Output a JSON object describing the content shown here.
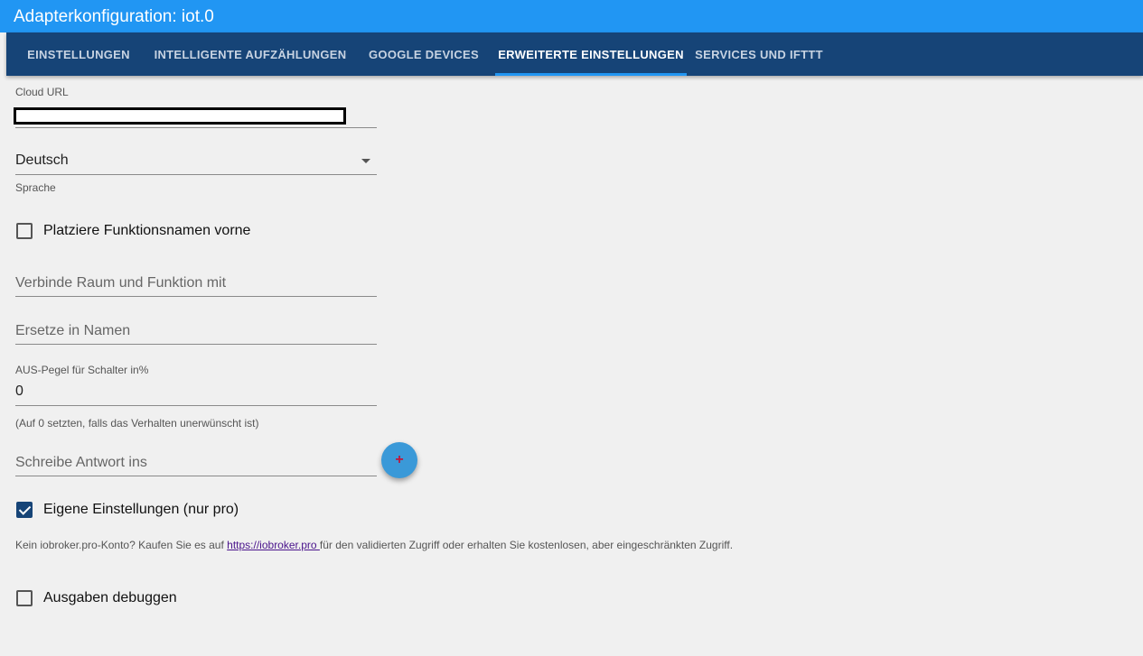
{
  "window": {
    "title": "Adapterkonfiguration: iot.0"
  },
  "tabs": [
    {
      "label": "EINSTELLUNGEN",
      "active": false
    },
    {
      "label": "INTELLIGENTE AUFZÄHLUNGEN",
      "active": false
    },
    {
      "label": "GOOGLE DEVICES",
      "active": false
    },
    {
      "label": "ERWEITERTE EINSTELLUNGEN",
      "active": true
    },
    {
      "label": "SERVICES UND IFTTT",
      "active": false
    }
  ],
  "form": {
    "cloud_url": {
      "label": "Cloud URL",
      "value": ""
    },
    "language": {
      "value": "Deutsch",
      "helper": "Sprache"
    },
    "function_first": {
      "label": "Platziere Funktionsnamen vorne",
      "checked": false
    },
    "concatenate": {
      "placeholder": "Verbinde Raum und Funktion mit",
      "value": ""
    },
    "replace": {
      "placeholder": "Ersetze in Namen",
      "value": ""
    },
    "off_level": {
      "label": "AUS-Pegel für Schalter in%",
      "value": "0",
      "helper": "(Auf 0 setzten, falls das Verhalten unerwünscht ist)"
    },
    "response_oid": {
      "placeholder": "Schreibe Antwort ins",
      "value": "",
      "add_glyph": "+"
    },
    "own_settings": {
      "label": "Eigene Einstellungen (nur pro)",
      "checked": true
    },
    "pro_info": {
      "prefix": "Kein iobroker.pro-Konto? Kaufen Sie es auf ",
      "link": "https://iobroker.pro ",
      "suffix": "für den validierten Zugriff oder erhalten Sie kostenlosen, aber eingeschränkten Zugriff."
    },
    "debug": {
      "label": "Ausgaben debuggen",
      "checked": false
    }
  },
  "colors": {
    "titlebar": "#2196f3",
    "tabbar": "#164477",
    "indicator": "#2196f3",
    "fab": "#3a99d8"
  }
}
